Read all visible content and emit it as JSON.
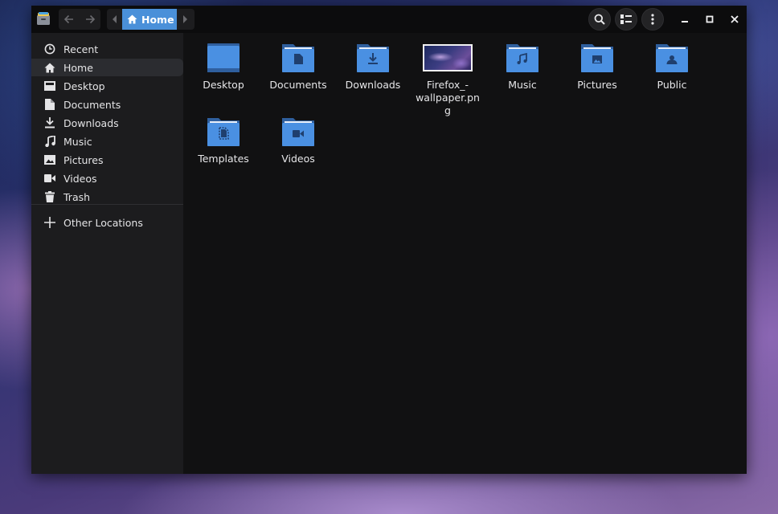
{
  "window": {
    "app_icon": "file-manager-icon",
    "accent": "#4a90d9"
  },
  "toolbar": {
    "back_icon": "arrow-left-icon",
    "forward_icon": "arrow-right-icon",
    "path_current": "Home",
    "search_icon": "search-icon",
    "view_icon": "list-view-icon",
    "menu_icon": "kebab-menu-icon",
    "minimize_icon": "minimize-icon",
    "maximize_icon": "maximize-icon",
    "close_icon": "close-icon"
  },
  "sidebar": {
    "items": [
      {
        "label": "Recent",
        "icon": "clock-icon"
      },
      {
        "label": "Home",
        "icon": "home-icon",
        "active": true
      },
      {
        "label": "Desktop",
        "icon": "desktop-icon"
      },
      {
        "label": "Documents",
        "icon": "document-icon"
      },
      {
        "label": "Downloads",
        "icon": "download-icon"
      },
      {
        "label": "Music",
        "icon": "music-icon"
      },
      {
        "label": "Pictures",
        "icon": "picture-icon"
      },
      {
        "label": "Videos",
        "icon": "video-icon"
      },
      {
        "label": "Trash",
        "icon": "trash-icon"
      }
    ],
    "other_locations": {
      "label": "Other Locations",
      "icon": "plus-icon"
    }
  },
  "files": [
    {
      "label": "Desktop",
      "icon": "folder-desktop-icon"
    },
    {
      "label": "Documents",
      "icon": "folder-documents-icon"
    },
    {
      "label": "Downloads",
      "icon": "folder-downloads-icon"
    },
    {
      "label": "Firefox_-wallpaper.png",
      "icon": "image-thumbnail-icon"
    },
    {
      "label": "Music",
      "icon": "folder-music-icon"
    },
    {
      "label": "Pictures",
      "icon": "folder-pictures-icon"
    },
    {
      "label": "Public",
      "icon": "folder-public-icon"
    },
    {
      "label": "Templates",
      "icon": "folder-templates-icon"
    },
    {
      "label": "Videos",
      "icon": "folder-videos-icon"
    }
  ]
}
